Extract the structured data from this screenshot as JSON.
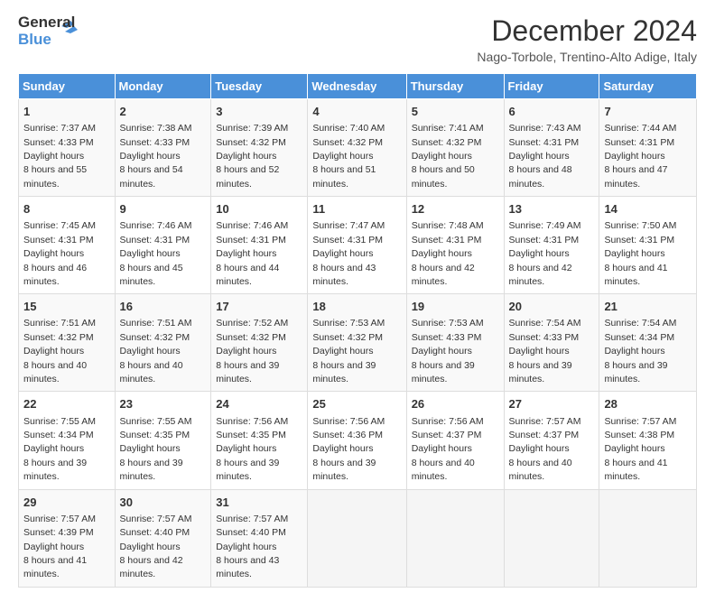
{
  "header": {
    "logo_line1": "General",
    "logo_line2": "Blue",
    "title": "December 2024",
    "subtitle": "Nago-Torbole, Trentino-Alto Adige, Italy"
  },
  "calendar": {
    "days_of_week": [
      "Sunday",
      "Monday",
      "Tuesday",
      "Wednesday",
      "Thursday",
      "Friday",
      "Saturday"
    ],
    "weeks": [
      [
        {
          "day": 1,
          "sunrise": "7:37 AM",
          "sunset": "4:33 PM",
          "daylight": "8 hours and 55 minutes."
        },
        {
          "day": 2,
          "sunrise": "7:38 AM",
          "sunset": "4:33 PM",
          "daylight": "8 hours and 54 minutes."
        },
        {
          "day": 3,
          "sunrise": "7:39 AM",
          "sunset": "4:32 PM",
          "daylight": "8 hours and 52 minutes."
        },
        {
          "day": 4,
          "sunrise": "7:40 AM",
          "sunset": "4:32 PM",
          "daylight": "8 hours and 51 minutes."
        },
        {
          "day": 5,
          "sunrise": "7:41 AM",
          "sunset": "4:32 PM",
          "daylight": "8 hours and 50 minutes."
        },
        {
          "day": 6,
          "sunrise": "7:43 AM",
          "sunset": "4:31 PM",
          "daylight": "8 hours and 48 minutes."
        },
        {
          "day": 7,
          "sunrise": "7:44 AM",
          "sunset": "4:31 PM",
          "daylight": "8 hours and 47 minutes."
        }
      ],
      [
        {
          "day": 8,
          "sunrise": "7:45 AM",
          "sunset": "4:31 PM",
          "daylight": "8 hours and 46 minutes."
        },
        {
          "day": 9,
          "sunrise": "7:46 AM",
          "sunset": "4:31 PM",
          "daylight": "8 hours and 45 minutes."
        },
        {
          "day": 10,
          "sunrise": "7:46 AM",
          "sunset": "4:31 PM",
          "daylight": "8 hours and 44 minutes."
        },
        {
          "day": 11,
          "sunrise": "7:47 AM",
          "sunset": "4:31 PM",
          "daylight": "8 hours and 43 minutes."
        },
        {
          "day": 12,
          "sunrise": "7:48 AM",
          "sunset": "4:31 PM",
          "daylight": "8 hours and 42 minutes."
        },
        {
          "day": 13,
          "sunrise": "7:49 AM",
          "sunset": "4:31 PM",
          "daylight": "8 hours and 42 minutes."
        },
        {
          "day": 14,
          "sunrise": "7:50 AM",
          "sunset": "4:31 PM",
          "daylight": "8 hours and 41 minutes."
        }
      ],
      [
        {
          "day": 15,
          "sunrise": "7:51 AM",
          "sunset": "4:32 PM",
          "daylight": "8 hours and 40 minutes."
        },
        {
          "day": 16,
          "sunrise": "7:51 AM",
          "sunset": "4:32 PM",
          "daylight": "8 hours and 40 minutes."
        },
        {
          "day": 17,
          "sunrise": "7:52 AM",
          "sunset": "4:32 PM",
          "daylight": "8 hours and 39 minutes."
        },
        {
          "day": 18,
          "sunrise": "7:53 AM",
          "sunset": "4:32 PM",
          "daylight": "8 hours and 39 minutes."
        },
        {
          "day": 19,
          "sunrise": "7:53 AM",
          "sunset": "4:33 PM",
          "daylight": "8 hours and 39 minutes."
        },
        {
          "day": 20,
          "sunrise": "7:54 AM",
          "sunset": "4:33 PM",
          "daylight": "8 hours and 39 minutes."
        },
        {
          "day": 21,
          "sunrise": "7:54 AM",
          "sunset": "4:34 PM",
          "daylight": "8 hours and 39 minutes."
        }
      ],
      [
        {
          "day": 22,
          "sunrise": "7:55 AM",
          "sunset": "4:34 PM",
          "daylight": "8 hours and 39 minutes."
        },
        {
          "day": 23,
          "sunrise": "7:55 AM",
          "sunset": "4:35 PM",
          "daylight": "8 hours and 39 minutes."
        },
        {
          "day": 24,
          "sunrise": "7:56 AM",
          "sunset": "4:35 PM",
          "daylight": "8 hours and 39 minutes."
        },
        {
          "day": 25,
          "sunrise": "7:56 AM",
          "sunset": "4:36 PM",
          "daylight": "8 hours and 39 minutes."
        },
        {
          "day": 26,
          "sunrise": "7:56 AM",
          "sunset": "4:37 PM",
          "daylight": "8 hours and 40 minutes."
        },
        {
          "day": 27,
          "sunrise": "7:57 AM",
          "sunset": "4:37 PM",
          "daylight": "8 hours and 40 minutes."
        },
        {
          "day": 28,
          "sunrise": "7:57 AM",
          "sunset": "4:38 PM",
          "daylight": "8 hours and 41 minutes."
        }
      ],
      [
        {
          "day": 29,
          "sunrise": "7:57 AM",
          "sunset": "4:39 PM",
          "daylight": "8 hours and 41 minutes."
        },
        {
          "day": 30,
          "sunrise": "7:57 AM",
          "sunset": "4:40 PM",
          "daylight": "8 hours and 42 minutes."
        },
        {
          "day": 31,
          "sunrise": "7:57 AM",
          "sunset": "4:40 PM",
          "daylight": "8 hours and 43 minutes."
        },
        null,
        null,
        null,
        null
      ]
    ]
  }
}
